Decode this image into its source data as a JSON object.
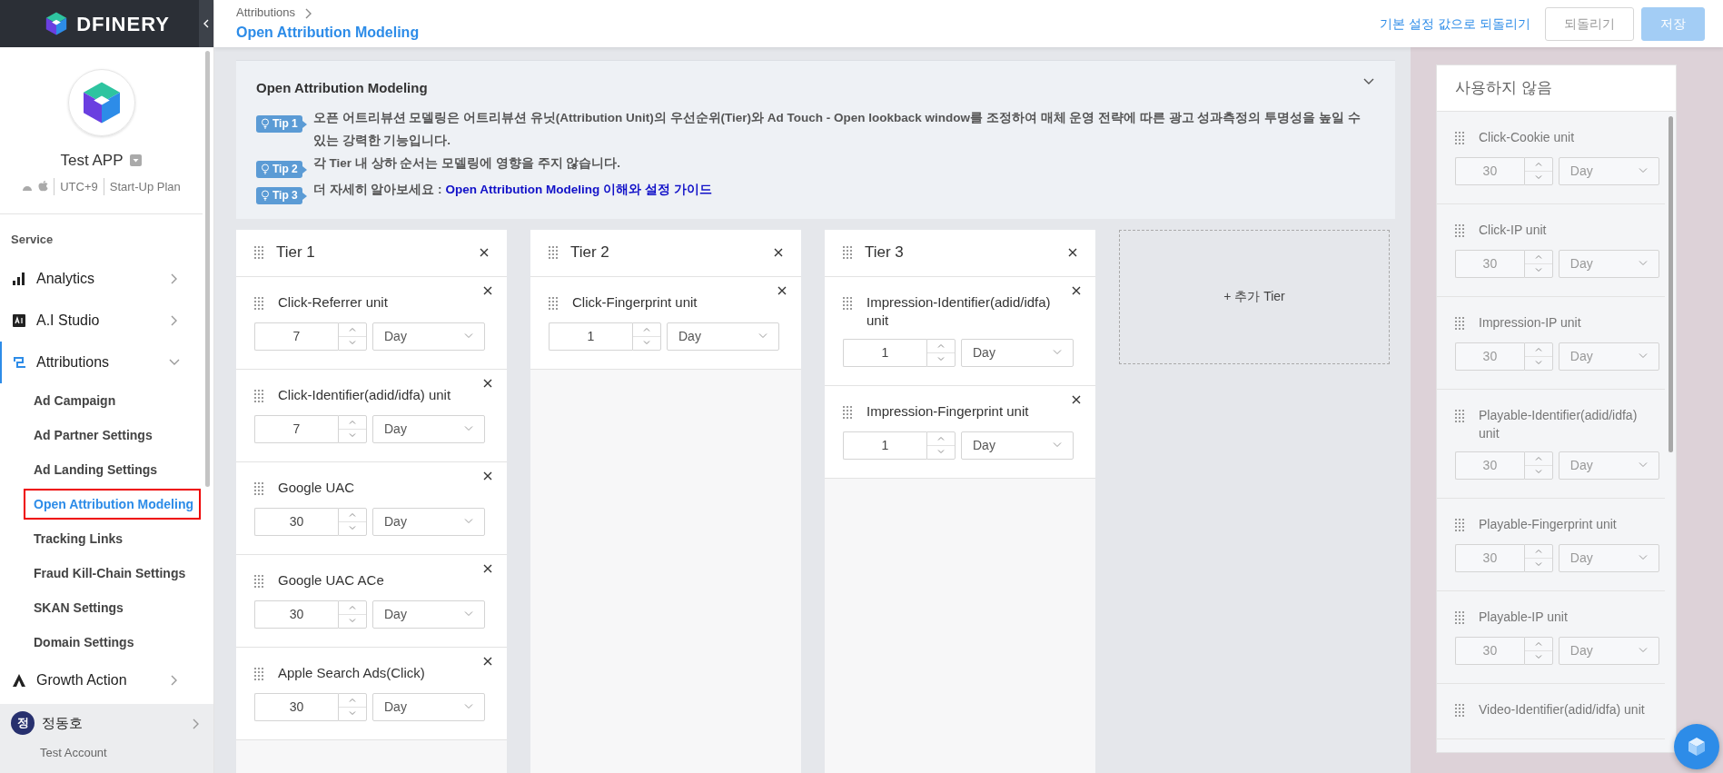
{
  "sidebar": {
    "logo": "DFINERY",
    "app": {
      "name": "Test APP",
      "timezone": "UTC+9",
      "plan": "Start-Up Plan"
    },
    "section": "Service",
    "items": [
      {
        "label": "Analytics",
        "expanded": false,
        "selected": false
      },
      {
        "label": "A.I Studio",
        "expanded": false,
        "selected": false
      },
      {
        "label": "Attributions",
        "expanded": true,
        "selected": true,
        "children": [
          {
            "label": "Ad Campaign",
            "selected": false,
            "annotated": false
          },
          {
            "label": "Ad Partner Settings",
            "selected": false,
            "annotated": false
          },
          {
            "label": "Ad Landing Settings",
            "selected": false,
            "annotated": false
          },
          {
            "label": "Open Attribution Modeling",
            "selected": true,
            "annotated": true
          },
          {
            "label": "Tracking Links",
            "selected": false,
            "annotated": false
          },
          {
            "label": "Fraud Kill-Chain Settings",
            "selected": false,
            "annotated": false
          },
          {
            "label": "SKAN Settings",
            "selected": false,
            "annotated": false
          },
          {
            "label": "Domain Settings",
            "selected": false,
            "annotated": false
          }
        ]
      },
      {
        "label": "Growth Action",
        "expanded": false,
        "selected": false
      }
    ],
    "user": {
      "initial": "정",
      "name": "정동호",
      "account": "Test Account"
    }
  },
  "header": {
    "breadcrumb": "Attributions",
    "title": "Open Attribution Modeling",
    "reset_link": "기본 설정 값으로 되돌리기",
    "buttons": [
      {
        "label": "되돌리기",
        "kind": "outline",
        "disabled": true
      },
      {
        "label": "저장",
        "kind": "primary",
        "disabled": true
      }
    ]
  },
  "info": {
    "title": "Open Attribution Modeling",
    "expanded": true,
    "tips": [
      {
        "badge": "Tip 1",
        "text": "오픈 어트리뷰션 모델링은 어트리뷰션 유닛(Attribution Unit)의 우선순위(Tier)와 Ad Touch - Open lookback window를 조정하여 매체 운영 전략에 따른 광고 성과측정의 투명성을 높일 수 있는 강력한 기능입니다."
      },
      {
        "badge": "Tip 2",
        "text": "각 Tier 내 상하 순서는 모델링에 영향을 주지 않습니다."
      },
      {
        "badge": "Tip 3",
        "text": "더 자세히 알아보세요 :",
        "link": "Open Attribution Modeling 이해와 설정 가이드"
      }
    ]
  },
  "tiers": [
    {
      "title": "Tier 1",
      "units": [
        {
          "name": "Click-Referrer unit",
          "value": "7",
          "unit": "Day"
        },
        {
          "name": "Click-Identifier(adid/idfa) unit",
          "value": "7",
          "unit": "Day"
        },
        {
          "name": "Google UAC",
          "value": "30",
          "unit": "Day"
        },
        {
          "name": "Google UAC ACe",
          "value": "30",
          "unit": "Day"
        },
        {
          "name": "Apple Search Ads(Click)",
          "value": "30",
          "unit": "Day"
        }
      ]
    },
    {
      "title": "Tier 2",
      "units": [
        {
          "name": "Click-Fingerprint unit",
          "value": "1",
          "unit": "Day"
        }
      ]
    },
    {
      "title": "Tier 3",
      "units": [
        {
          "name": "Impression-Identifier(adid/idfa) unit",
          "value": "1",
          "unit": "Day"
        },
        {
          "name": "Impression-Fingerprint unit",
          "value": "1",
          "unit": "Day"
        }
      ]
    }
  ],
  "add_tier": "+ 추가 Tier",
  "unused": {
    "title": "사용하지 않음",
    "disabled": true,
    "units": [
      {
        "name": "Click-Cookie unit",
        "value": "30",
        "unit": "Day"
      },
      {
        "name": "Click-IP unit",
        "value": "30",
        "unit": "Day"
      },
      {
        "name": "Impression-IP unit",
        "value": "30",
        "unit": "Day"
      },
      {
        "name": "Playable-Identifier(adid/idfa) unit",
        "value": "30",
        "unit": "Day"
      },
      {
        "name": "Playable-Fingerprint unit",
        "value": "30",
        "unit": "Day"
      },
      {
        "name": "Playable-IP unit",
        "value": "30",
        "unit": "Day"
      },
      {
        "name": "Video-Identifier(adid/idfa) unit"
      }
    ]
  }
}
